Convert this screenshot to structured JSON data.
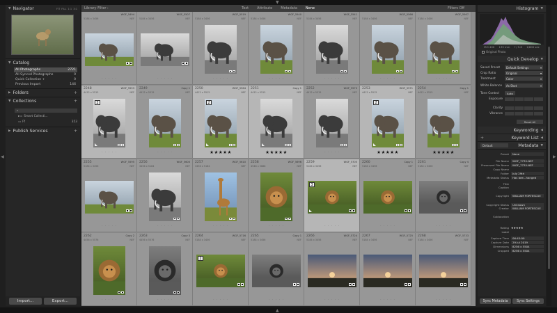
{
  "left_panel": {
    "navigator": {
      "title": "Navigator",
      "modes": [
        "FIT",
        "FILL",
        "1:1",
        "3:1"
      ]
    },
    "catalog": {
      "title": "Catalog",
      "items": [
        {
          "label": "All Photographs",
          "count": "2721"
        },
        {
          "label": "All Synced Photographs",
          "count": "0"
        },
        {
          "label": "Quick Collection +",
          "count": "0"
        },
        {
          "label": "Previous Import",
          "count": "146"
        }
      ]
    },
    "folders": {
      "title": "Folders"
    },
    "collections": {
      "title": "Collections",
      "search_placeholder": "Filter Collections",
      "smart_label": "Smart Collecti...",
      "item": {
        "label": "Ff",
        "count": "353"
      }
    },
    "publish": {
      "title": "Publish Services"
    },
    "import_label": "Import...",
    "export_label": "Export..."
  },
  "filter_bar": {
    "label": "Library Filter :",
    "tabs": [
      "Text",
      "Attribute",
      "Metadata",
      "None"
    ],
    "active_tab": "None",
    "status": "Filters Off"
  },
  "grid": {
    "rows": [
      [
        {
          "num": "",
          "fname": "WGF_5494",
          "meta": "5184 x 3456",
          "crop": "NEF"
        },
        {
          "num": "",
          "fname": "WGF_5507",
          "meta": "5184 x 3456",
          "crop": "NEF"
        },
        {
          "num": "",
          "fname": "WGF_5519",
          "meta": "5184 x 3456",
          "crop": "NEF"
        },
        {
          "num": "",
          "fname": "WGF_5540",
          "meta": "5184 x 3456",
          "crop": "NEF"
        },
        {
          "num": "",
          "fname": "WGF_5541",
          "meta": "5184 x 3456",
          "crop": "NEF"
        },
        {
          "num": "",
          "fname": "WGF_5566",
          "meta": "5184 x 3456",
          "crop": "NEF"
        },
        {
          "num": "",
          "fname": "WGF_5567",
          "meta": "5184 x 3456",
          "crop": "NEF"
        }
      ],
      [
        {
          "num": "2248",
          "fname": "WGF_5553",
          "meta": "4412 x 5515",
          "crop": "NEF"
        },
        {
          "num": "2249",
          "fname": "Copy 1",
          "meta": "4412 x 5515",
          "crop": "NEF"
        },
        {
          "num": "2250",
          "fname": "WGF_5564",
          "meta": "4412 x 5515",
          "crop": "NEF"
        },
        {
          "num": "2251",
          "fname": "Copy 1",
          "meta": "4412 x 5515",
          "crop": "NEF"
        },
        {
          "num": "2252",
          "fname": "WGF_5570",
          "meta": "4412 x 5515",
          "crop": "NEF"
        },
        {
          "num": "2253",
          "fname": "WGF_5571",
          "meta": "4412 x 5515",
          "crop": "NEF"
        },
        {
          "num": "2254",
          "fname": "Copy 1",
          "meta": "4412 x 5515",
          "crop": "NEF"
        }
      ],
      [
        {
          "num": "2255",
          "fname": "WGF_5595",
          "meta": "5184 x 3456",
          "crop": "NEF"
        },
        {
          "num": "2256",
          "fname": "WGF_5600",
          "meta": "3456 x 5184",
          "crop": "NEF"
        },
        {
          "num": "2257",
          "fname": "WGF_5610",
          "meta": "3456 x 5184",
          "crop": "NEF"
        },
        {
          "num": "2258",
          "fname": "WGF_5696",
          "meta": "4548 x 5888",
          "crop": "NEF"
        },
        {
          "num": "2259",
          "fname": "WGF_5705",
          "meta": "5184 x 3456",
          "crop": "NEF"
        },
        {
          "num": "2260",
          "fname": "Copy 1",
          "meta": "5184 x 3456",
          "crop": "NEF"
        },
        {
          "num": "2261",
          "fname": "Copy 4",
          "meta": "5184 x 3456",
          "crop": "NEF"
        }
      ],
      [
        {
          "num": "2262",
          "fname": "Copy 2",
          "meta": "4456 x 5576",
          "crop": "NEF"
        },
        {
          "num": "2263",
          "fname": "Copy 3",
          "meta": "4456 x 5576",
          "crop": "NEF"
        },
        {
          "num": "2264",
          "fname": "WGF_5716",
          "meta": "5184 x 3456",
          "crop": "NEF"
        },
        {
          "num": "2265",
          "fname": "Copy 1",
          "meta": "5184 x 3456",
          "crop": "NEF"
        },
        {
          "num": "2266",
          "fname": "WGF_5724",
          "meta": "5184 x 3456",
          "crop": "NEF"
        },
        {
          "num": "2267",
          "fname": "WGF_5725",
          "meta": "5184 x 3456",
          "crop": "NEF"
        },
        {
          "num": "2268",
          "fname": "WGF_5733",
          "meta": "5184 x 3456",
          "crop": "NEF"
        }
      ]
    ],
    "star_rating": "★★★★★",
    "stack_badges": [
      "2",
      "2",
      "2",
      "3",
      "2"
    ]
  },
  "right_panel": {
    "histogram": {
      "title": "Histogram",
      "info": [
        "ISO 400",
        "135 mm",
        "f / 5.6",
        "1/800 sec"
      ],
      "original_label": "Original Photo"
    },
    "quick_develop": {
      "title": "Quick Develop",
      "rows": [
        {
          "label": "Saved Preset",
          "value": "Default Settings"
        },
        {
          "label": "Crop Ratio",
          "value": "Original"
        },
        {
          "label": "Treatment",
          "value": "Color"
        },
        {
          "label": "White Balance",
          "value": "As Shot"
        }
      ],
      "tone_control": "Tone Control",
      "auto_label": "Auto",
      "adjust_rows": [
        "Exposure",
        "Clarity",
        "Vibrance"
      ],
      "reset_label": "Reset All"
    },
    "keywording": {
      "title": "Keywording"
    },
    "keyword_list": {
      "title": "Keyword List"
    },
    "metadata": {
      "title": "Metadata",
      "preset_select": "Default",
      "preset_label": "Preset",
      "preset_value": "None",
      "rows": [
        {
          "k": "File Name",
          "v": "WGF_7735.NEF"
        },
        {
          "k": "Preserved File Name",
          "v": "WGF_7735.NEF"
        },
        {
          "k": "Copy Name",
          "v": ""
        },
        {
          "k": "Folder",
          "v": "July 29th"
        },
        {
          "k": "Metadata Status",
          "v": "Has bee...hanged"
        },
        {
          "k": "Title",
          "v": ""
        },
        {
          "k": "Caption",
          "v": ""
        },
        {
          "k": "Copyright",
          "v": "WILLIAM FORTESCUE"
        },
        {
          "k": "Copyright Status",
          "v": "Unknown"
        },
        {
          "k": "Creator",
          "v": "WILLIAM FORTESCUE"
        },
        {
          "k": "Sublocation",
          "v": ""
        },
        {
          "k": "Rating",
          "v": "★★★★★"
        },
        {
          "k": "Label",
          "v": ""
        },
        {
          "k": "Capture Time",
          "v": "06:45:00"
        },
        {
          "k": "Capture Date",
          "v": "29 Jul 2019"
        },
        {
          "k": "Dimensions",
          "v": "8256 x 5504"
        },
        {
          "k": "Cropped",
          "v": "8256 x 5504"
        }
      ]
    },
    "sync_metadata": "Sync Metadata",
    "sync_settings": "Sync Settings"
  },
  "colors": {
    "panel": "#262626",
    "grid_bg": "#8a8a8a",
    "cell": "#979797",
    "cell_selected": "#b6b6b6"
  }
}
